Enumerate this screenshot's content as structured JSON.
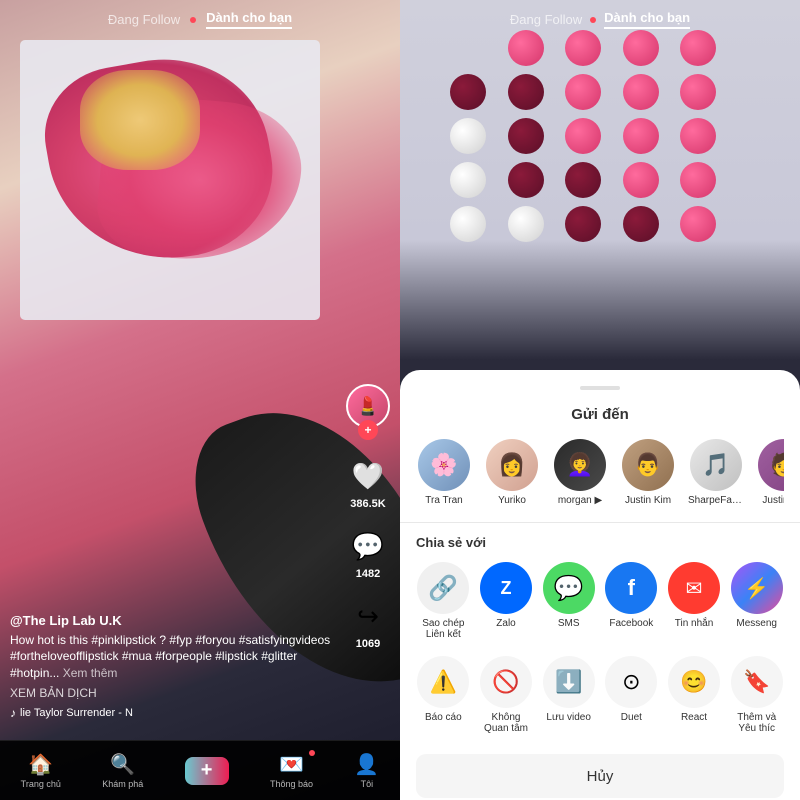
{
  "left": {
    "nav": {
      "following_label": "Đang Follow",
      "dot": "•",
      "foryou_label": "Dành cho bạn"
    },
    "user": "@The Lip Lab U.K",
    "caption": "How hot is this #pinklipstick ? #fyp #foryou #satisfyingvideos #fortheloveofflipstick #mua #forpeople #lipstick #glitter #hotpin...",
    "see_more": "Xem thêm",
    "translate": "XEM BẢN DỊCH",
    "music_note": "♪",
    "music_text": "lie Taylor  Surrender - N",
    "likes": "386.5K",
    "comments": "1482",
    "shares": "1069",
    "bottom_nav": {
      "home_label": "Trang chủ",
      "search_label": "Khám phá",
      "add_label": "+",
      "inbox_label": "Thông báo",
      "profile_label": "Tôi"
    }
  },
  "right": {
    "nav": {
      "following_label": "Đang Follow",
      "dot": "•",
      "foryou_label": "Dành cho bạn"
    },
    "share_sheet": {
      "title": "Gửi đến",
      "share_with": "Chia sẻ với",
      "friends": [
        {
          "name": "Tra Tran",
          "avatar": "🌸"
        },
        {
          "name": "Yuriko",
          "avatar": "👩"
        },
        {
          "name": "morgan ▶",
          "avatar": "👩‍🦱"
        },
        {
          "name": "Justin Kim",
          "avatar": "👨"
        },
        {
          "name": "SharpeFamilySingers",
          "avatar": "🎵"
        },
        {
          "name": "Justin Vib",
          "avatar": "🧑"
        }
      ],
      "share_options": [
        {
          "label": "Sao chép\nLiên kết",
          "icon": "🔗",
          "color": "sc-link"
        },
        {
          "label": "Zalo",
          "icon": "Z",
          "color": "sc-zalo"
        },
        {
          "label": "SMS",
          "icon": "💬",
          "color": "sc-sms"
        },
        {
          "label": "Facebook",
          "icon": "f",
          "color": "sc-fb"
        },
        {
          "label": "Tin nhắn",
          "icon": "✉",
          "color": "sc-tin"
        },
        {
          "label": "Messeng",
          "icon": "m",
          "color": "sc-mess"
        }
      ],
      "actions": [
        {
          "label": "Báo cáo",
          "icon": "⚠"
        },
        {
          "label": "Không\nQuan tâm",
          "icon": "🚫"
        },
        {
          "label": "Lưu video",
          "icon": "⬇"
        },
        {
          "label": "Duet",
          "icon": "⊙"
        },
        {
          "label": "React",
          "icon": "😊"
        },
        {
          "label": "Thêm và\nYêu thíc",
          "icon": "🔖"
        }
      ],
      "cancel": "Hủy"
    }
  }
}
